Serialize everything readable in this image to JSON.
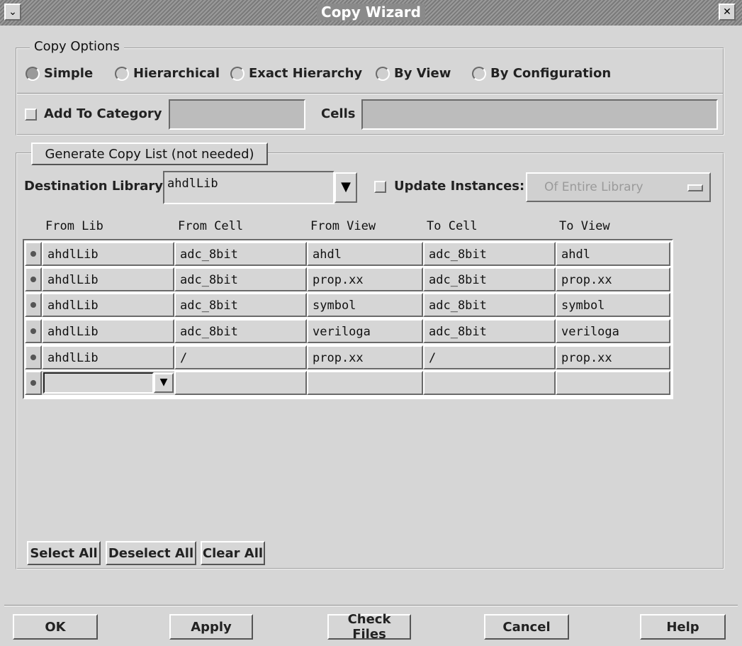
{
  "window": {
    "title": "Copy Wizard"
  },
  "copy_options": {
    "legend": "Copy Options",
    "radios": [
      "Simple",
      "Hierarchical",
      "Exact Hierarchy",
      "By View",
      "By Configuration"
    ],
    "selected": "Simple",
    "add_to_category_label": "Add To Category",
    "category_value": "",
    "cells_label": "Cells",
    "cells_value": ""
  },
  "generate": {
    "legend": "Generate Copy List (not needed)",
    "dest_lib_label": "Destination Library",
    "dest_lib_value": "ahdlLib",
    "update_instances_label": "Update Instances:",
    "update_scope_value": "Of Entire Library"
  },
  "table": {
    "headers": [
      "From Lib",
      "From Cell",
      "From View",
      "To Cell",
      "To View"
    ],
    "rows": [
      [
        "ahdlLib",
        "adc_8bit",
        "ahdl",
        "adc_8bit",
        "ahdl"
      ],
      [
        "ahdlLib",
        "adc_8bit",
        "prop.xx",
        "adc_8bit",
        "prop.xx"
      ],
      [
        "ahdlLib",
        "adc_8bit",
        "symbol",
        "adc_8bit",
        "symbol"
      ],
      [
        "ahdlLib",
        "adc_8bit",
        "veriloga",
        "adc_8bit",
        "veriloga"
      ],
      [
        "ahdlLib",
        "/",
        "prop.xx",
        "/",
        "prop.xx"
      ]
    ]
  },
  "list_buttons": {
    "select_all": "Select All",
    "deselect_all": "Deselect All",
    "clear_all": "Clear All"
  },
  "footer": {
    "ok": "OK",
    "apply": "Apply",
    "check_files": "Check Files",
    "cancel": "Cancel",
    "help": "Help"
  }
}
